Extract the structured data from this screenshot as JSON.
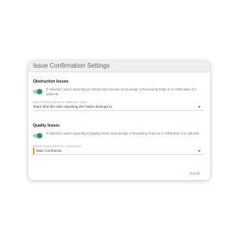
{
  "panel": {
    "title": "Issue Confirmation Settings",
    "save_label": "SAVE"
  },
  "obstruction": {
    "title": "Obstruction Issues",
    "toggle_on": true,
    "description": "If selected, users reporting an Obstruction Issues must assign a Reviewing Team to it. Otherwise it is optional.",
    "select_label": "Default Reviewing Team for Obstruction Issues",
    "select_value": "Team that the user reporting the Notes belongs to"
  },
  "quality": {
    "title": "Quality Issues",
    "toggle_on": true,
    "description": "If selected, users reporting a Quality Issue must assign a Reviewing Team to it. Otherwise it is optional.",
    "select_label": "Default Reviewing Team for Quality Issues",
    "select_value": "Main Contractor"
  },
  "colors": {
    "accent_green": "#2e9a5a",
    "save_green": "#3aa37a",
    "field_accent_orange": "#f0a030"
  }
}
